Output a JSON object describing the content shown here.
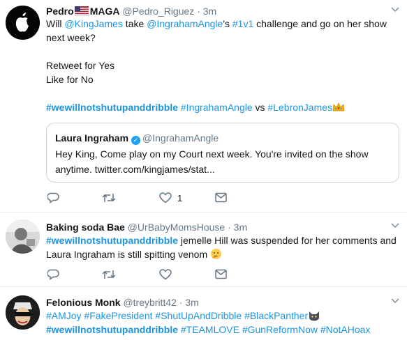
{
  "tweets": [
    {
      "name": "Pedro",
      "name_suffix": "MAGA",
      "handle": "@Pedro_Riguez",
      "dot": "·",
      "time": "3m",
      "line1_pre": "Will ",
      "line1_mention1": "@KingJames",
      "line1_mid": " take ",
      "line1_mention2": "@IngrahamAngle",
      "line1_poss": "'s ",
      "line1_tag": "#1v1",
      "line1_post": " challenge and go on her show",
      "line2": "next week?",
      "line3": "Retweet for Yes",
      "line4": "Like for No",
      "tag_a": "#wewillnotshutupanddribble",
      "tag_b": "#IngrahamAngle",
      "vs": " vs ",
      "tag_c": "#LebronJames",
      "quote": {
        "name": "Laura Ingraham",
        "handle": "@IngrahamAngle",
        "line1": "Hey King, Come play on my Court next week. You're invited on the show",
        "line2": "anytime. twitter.com/kingjames/stat..."
      },
      "like_count": "1"
    },
    {
      "name": "Baking soda Bae",
      "handle": "@UrBabyMomsHouse",
      "dot": "·",
      "time": "3m",
      "tag": "#wewillnotshutupanddribble",
      "line1_post": " jemelle Hill was suspended for her comments and",
      "line2": "Laura Ingraham is still spitting venom"
    },
    {
      "name": "Felonious Monk",
      "handle": "@treybritt42",
      "dot": "·",
      "time": "3m",
      "tags1": [
        "#AMJoy",
        "#FakePresident",
        "#ShutUpAndDribble",
        "#BlackPanther"
      ],
      "tag_bold": "#wewillnotshutupanddribble",
      "tags2": [
        "#TEAMLOVE",
        "#GunReformNow",
        "#NotAHoax"
      ]
    }
  ],
  "icons": [
    "reply-icon",
    "retweet-icon",
    "like-icon",
    "message-icon",
    "chevron-down-icon",
    "verified-badge-icon",
    "crown-emoji",
    "thinking-emoji",
    "cat-emoji",
    "us-flag"
  ],
  "colors": {
    "link": "#1b95e0",
    "muted": "#657786",
    "verified": "#1da1f2",
    "border": "#e6ecf0"
  }
}
